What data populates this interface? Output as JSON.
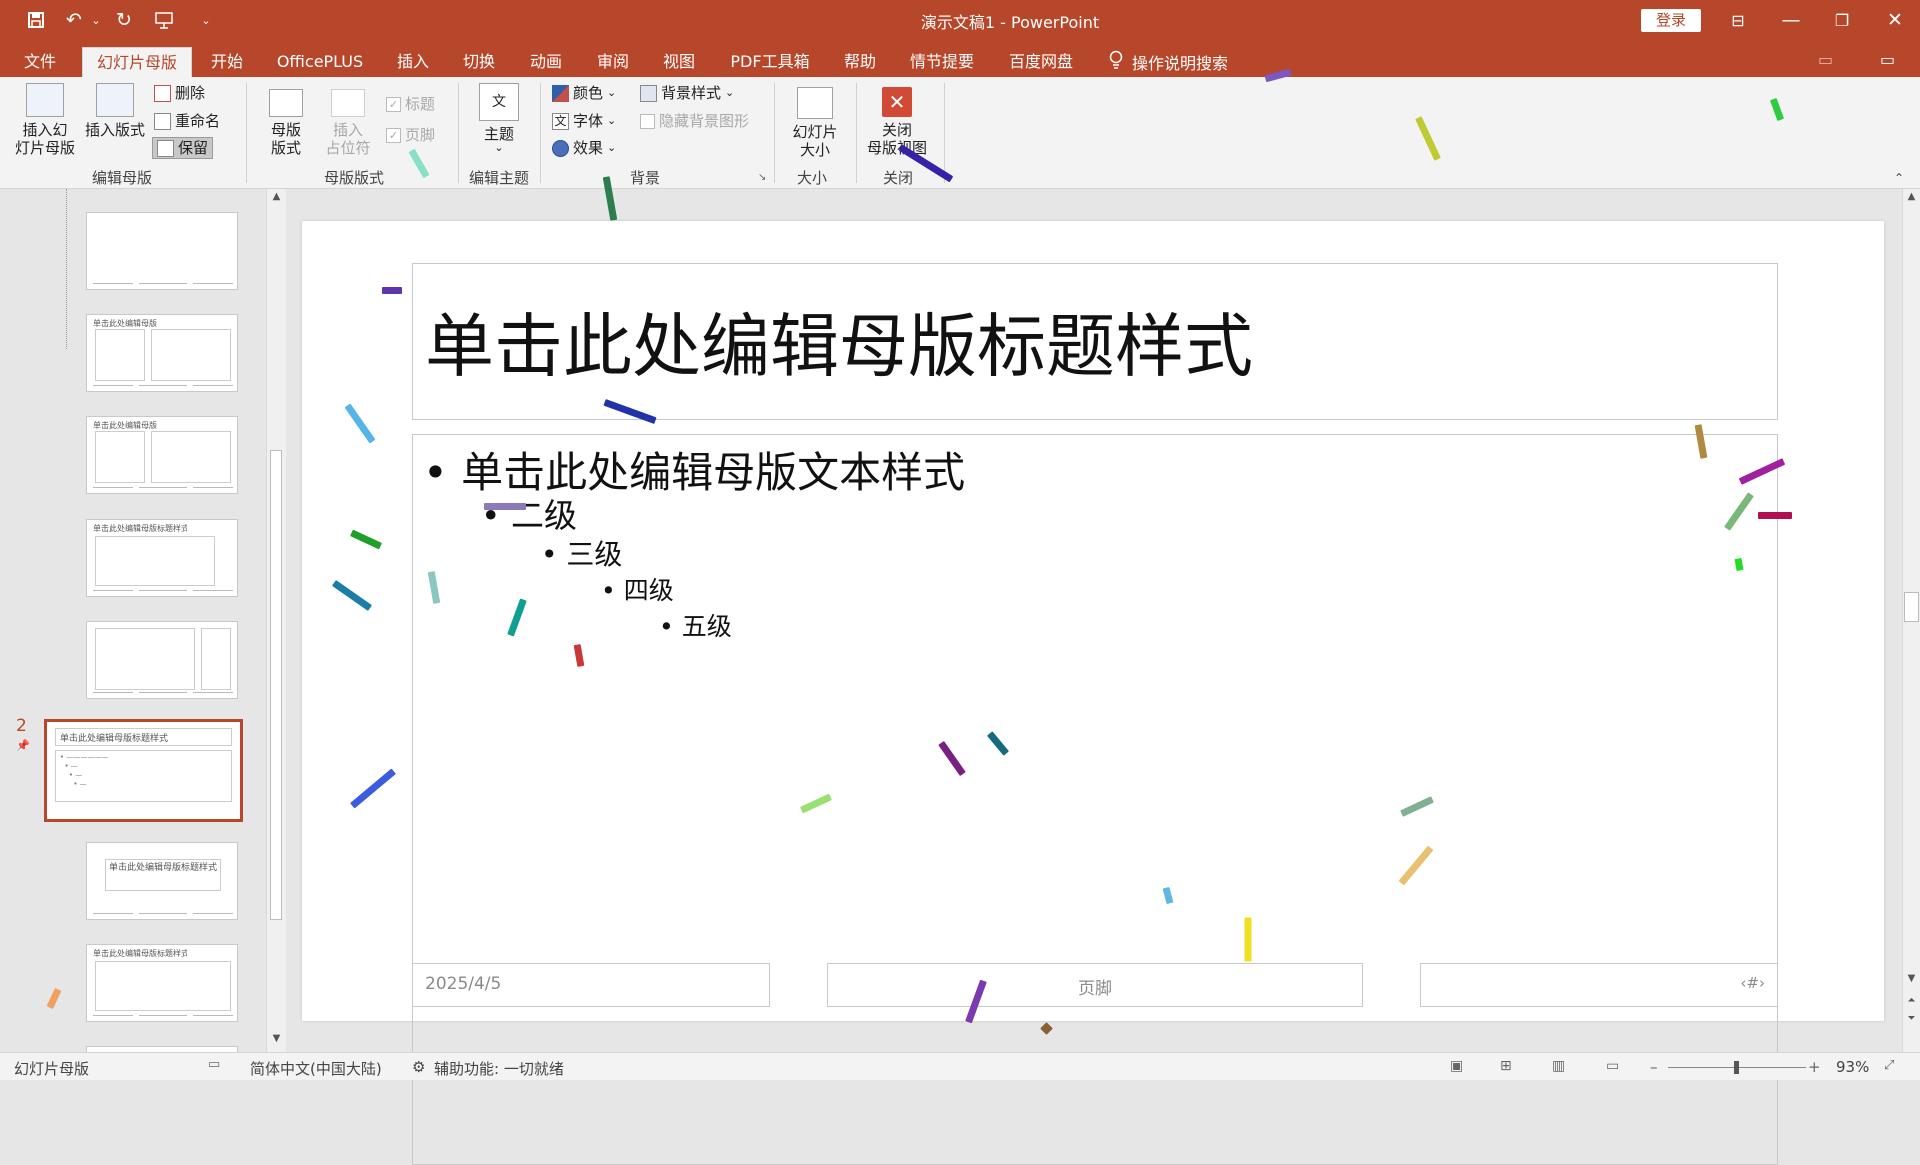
{
  "window": {
    "title": "演示文稿1  -  PowerPoint",
    "login_label": "登录"
  },
  "tabs": [
    {
      "label": "文件"
    },
    {
      "label": "幻灯片母版"
    },
    {
      "label": "开始"
    },
    {
      "label": "OfficePLUS"
    },
    {
      "label": "插入"
    },
    {
      "label": "切换"
    },
    {
      "label": "动画"
    },
    {
      "label": "审阅"
    },
    {
      "label": "视图"
    },
    {
      "label": "PDF工具箱"
    },
    {
      "label": "帮助"
    },
    {
      "label": "情节提要"
    },
    {
      "label": "百度网盘"
    },
    {
      "label": "操作说明搜索"
    }
  ],
  "ribbon": {
    "edit_master": {
      "insert_slide_master": "插入幻\n灯片母版",
      "insert_layout": "插入版式",
      "delete": "删除",
      "rename": "重命名",
      "preserve": "保留",
      "group": "编辑母版"
    },
    "master_layout": {
      "master_layout_btn": "母版\n版式",
      "insert_placeholder": "插入\n占位符",
      "title_check": "标题",
      "footer_check": "页脚",
      "group": "母版版式"
    },
    "edit_theme": {
      "themes": "主题",
      "group": "编辑主题"
    },
    "background": {
      "colors": "颜色",
      "fonts": "字体",
      "effects": "效果",
      "background_styles": "背景样式",
      "hide_background": "隐藏背景图形",
      "group": "背景"
    },
    "size": {
      "slide_size": "幻灯片\n大小",
      "group": "大小"
    },
    "close": {
      "close_master": "关闭\n母版视图",
      "group": "关闭"
    }
  },
  "thumbnails": {
    "selected_number": "2",
    "items": [
      {
        "title": ""
      },
      {
        "title": "单击此处编辑母版标题样式"
      },
      {
        "title": "单击此处编辑母版标题样式"
      },
      {
        "title": "单击此处编辑母版标题样式"
      },
      {
        "title": ""
      },
      {
        "title": "单击此处编辑母版标题样式"
      },
      {
        "title": "单击此处编辑母版标题样式"
      },
      {
        "title": "单击此处编辑母版标题样式"
      }
    ]
  },
  "slide": {
    "title": "单击此处编辑母版标题样式",
    "levels": [
      "单击此处编辑母版文本样式",
      "二级",
      "三级",
      "四级",
      "五级"
    ],
    "date": "2025/4/5",
    "footer": "页脚",
    "number": "‹#›"
  },
  "status": {
    "view_name": "幻灯片母版",
    "language": "简体中文(中国大陆)",
    "accessibility": "辅助功能: 一切就绪",
    "zoom": "93%",
    "zoom_level": 0.93
  },
  "colors": {
    "accent": "#b7472a",
    "ribbon_bg": "#f3f3f3"
  }
}
